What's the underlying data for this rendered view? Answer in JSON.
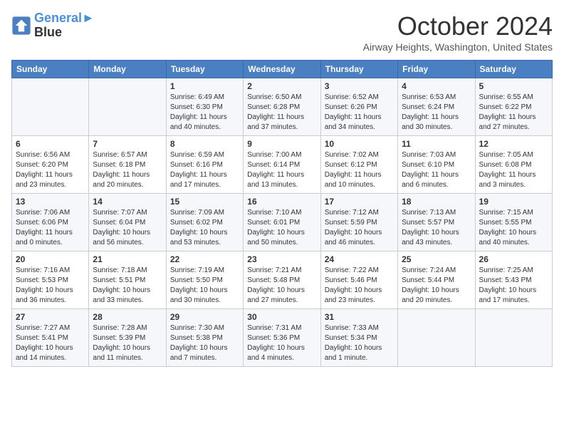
{
  "header": {
    "logo_line1": "General",
    "logo_line2": "Blue",
    "month_title": "October 2024",
    "location": "Airway Heights, Washington, United States"
  },
  "weekdays": [
    "Sunday",
    "Monday",
    "Tuesday",
    "Wednesday",
    "Thursday",
    "Friday",
    "Saturday"
  ],
  "weeks": [
    [
      {
        "day": "",
        "info": ""
      },
      {
        "day": "",
        "info": ""
      },
      {
        "day": "1",
        "info": "Sunrise: 6:49 AM\nSunset: 6:30 PM\nDaylight: 11 hours and 40 minutes."
      },
      {
        "day": "2",
        "info": "Sunrise: 6:50 AM\nSunset: 6:28 PM\nDaylight: 11 hours and 37 minutes."
      },
      {
        "day": "3",
        "info": "Sunrise: 6:52 AM\nSunset: 6:26 PM\nDaylight: 11 hours and 34 minutes."
      },
      {
        "day": "4",
        "info": "Sunrise: 6:53 AM\nSunset: 6:24 PM\nDaylight: 11 hours and 30 minutes."
      },
      {
        "day": "5",
        "info": "Sunrise: 6:55 AM\nSunset: 6:22 PM\nDaylight: 11 hours and 27 minutes."
      }
    ],
    [
      {
        "day": "6",
        "info": "Sunrise: 6:56 AM\nSunset: 6:20 PM\nDaylight: 11 hours and 23 minutes."
      },
      {
        "day": "7",
        "info": "Sunrise: 6:57 AM\nSunset: 6:18 PM\nDaylight: 11 hours and 20 minutes."
      },
      {
        "day": "8",
        "info": "Sunrise: 6:59 AM\nSunset: 6:16 PM\nDaylight: 11 hours and 17 minutes."
      },
      {
        "day": "9",
        "info": "Sunrise: 7:00 AM\nSunset: 6:14 PM\nDaylight: 11 hours and 13 minutes."
      },
      {
        "day": "10",
        "info": "Sunrise: 7:02 AM\nSunset: 6:12 PM\nDaylight: 11 hours and 10 minutes."
      },
      {
        "day": "11",
        "info": "Sunrise: 7:03 AM\nSunset: 6:10 PM\nDaylight: 11 hours and 6 minutes."
      },
      {
        "day": "12",
        "info": "Sunrise: 7:05 AM\nSunset: 6:08 PM\nDaylight: 11 hours and 3 minutes."
      }
    ],
    [
      {
        "day": "13",
        "info": "Sunrise: 7:06 AM\nSunset: 6:06 PM\nDaylight: 11 hours and 0 minutes."
      },
      {
        "day": "14",
        "info": "Sunrise: 7:07 AM\nSunset: 6:04 PM\nDaylight: 10 hours and 56 minutes."
      },
      {
        "day": "15",
        "info": "Sunrise: 7:09 AM\nSunset: 6:02 PM\nDaylight: 10 hours and 53 minutes."
      },
      {
        "day": "16",
        "info": "Sunrise: 7:10 AM\nSunset: 6:01 PM\nDaylight: 10 hours and 50 minutes."
      },
      {
        "day": "17",
        "info": "Sunrise: 7:12 AM\nSunset: 5:59 PM\nDaylight: 10 hours and 46 minutes."
      },
      {
        "day": "18",
        "info": "Sunrise: 7:13 AM\nSunset: 5:57 PM\nDaylight: 10 hours and 43 minutes."
      },
      {
        "day": "19",
        "info": "Sunrise: 7:15 AM\nSunset: 5:55 PM\nDaylight: 10 hours and 40 minutes."
      }
    ],
    [
      {
        "day": "20",
        "info": "Sunrise: 7:16 AM\nSunset: 5:53 PM\nDaylight: 10 hours and 36 minutes."
      },
      {
        "day": "21",
        "info": "Sunrise: 7:18 AM\nSunset: 5:51 PM\nDaylight: 10 hours and 33 minutes."
      },
      {
        "day": "22",
        "info": "Sunrise: 7:19 AM\nSunset: 5:50 PM\nDaylight: 10 hours and 30 minutes."
      },
      {
        "day": "23",
        "info": "Sunrise: 7:21 AM\nSunset: 5:48 PM\nDaylight: 10 hours and 27 minutes."
      },
      {
        "day": "24",
        "info": "Sunrise: 7:22 AM\nSunset: 5:46 PM\nDaylight: 10 hours and 23 minutes."
      },
      {
        "day": "25",
        "info": "Sunrise: 7:24 AM\nSunset: 5:44 PM\nDaylight: 10 hours and 20 minutes."
      },
      {
        "day": "26",
        "info": "Sunrise: 7:25 AM\nSunset: 5:43 PM\nDaylight: 10 hours and 17 minutes."
      }
    ],
    [
      {
        "day": "27",
        "info": "Sunrise: 7:27 AM\nSunset: 5:41 PM\nDaylight: 10 hours and 14 minutes."
      },
      {
        "day": "28",
        "info": "Sunrise: 7:28 AM\nSunset: 5:39 PM\nDaylight: 10 hours and 11 minutes."
      },
      {
        "day": "29",
        "info": "Sunrise: 7:30 AM\nSunset: 5:38 PM\nDaylight: 10 hours and 7 minutes."
      },
      {
        "day": "30",
        "info": "Sunrise: 7:31 AM\nSunset: 5:36 PM\nDaylight: 10 hours and 4 minutes."
      },
      {
        "day": "31",
        "info": "Sunrise: 7:33 AM\nSunset: 5:34 PM\nDaylight: 10 hours and 1 minute."
      },
      {
        "day": "",
        "info": ""
      },
      {
        "day": "",
        "info": ""
      }
    ]
  ]
}
